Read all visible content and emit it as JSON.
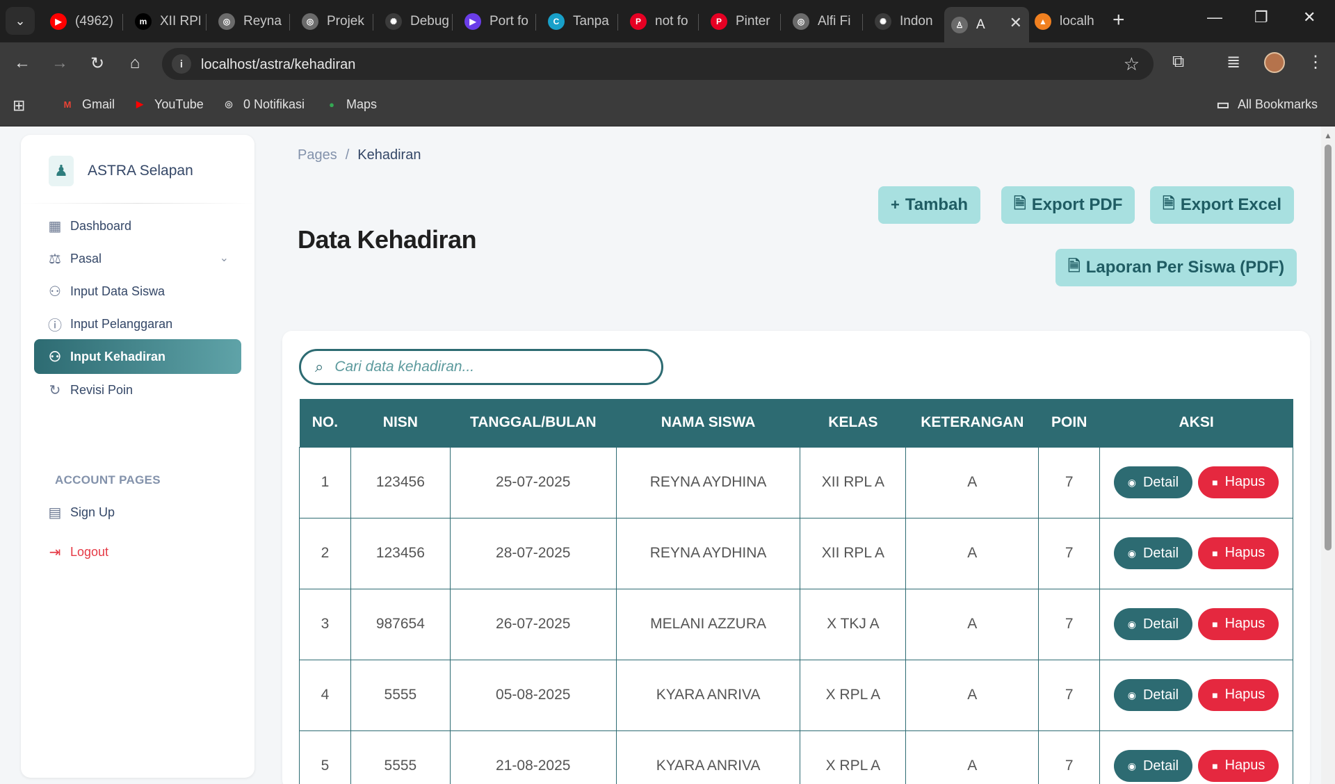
{
  "browser": {
    "tabs": [
      {
        "title": "(4962)",
        "fav_color": "#ff0000",
        "fav_glyph": "▶"
      },
      {
        "title": "XII RPL",
        "fav_color": "#000000",
        "fav_glyph": "m"
      },
      {
        "title": "Reyna",
        "fav_color": "#6b6b6b",
        "fav_glyph": "◎"
      },
      {
        "title": "Projek",
        "fav_color": "#6b6b6b",
        "fav_glyph": "◎"
      },
      {
        "title": "Debug",
        "fav_color": "#3b3b3b",
        "fav_glyph": "✺"
      },
      {
        "title": "Port fo",
        "fav_color": "#6a3de8",
        "fav_glyph": "▶"
      },
      {
        "title": "Tanpa",
        "fav_color": "#18a0c9",
        "fav_glyph": "C"
      },
      {
        "title": "not fo",
        "fav_color": "#e60023",
        "fav_glyph": "P"
      },
      {
        "title": "Pinter",
        "fav_color": "#e60023",
        "fav_glyph": "P"
      },
      {
        "title": "Alfi Fi",
        "fav_color": "#6b6b6b",
        "fav_glyph": "◎"
      },
      {
        "title": "Indon",
        "fav_color": "#3b3b3b",
        "fav_glyph": "✺"
      },
      {
        "title": "A",
        "fav_color": "#6b6b6b",
        "fav_glyph": "♙"
      },
      {
        "title": "localh",
        "fav_color": "#f08020",
        "fav_glyph": "▲"
      }
    ],
    "url": "localhost/astra/kehadiran",
    "bookmarks": [
      {
        "label": "Gmail",
        "color": "#ea4335",
        "glyph": "M"
      },
      {
        "label": "YouTube",
        "color": "#ff0000",
        "glyph": "▶"
      },
      {
        "label": "0 Notifikasi",
        "color": "#cfcfcf",
        "glyph": "◎"
      },
      {
        "label": "Maps",
        "color": "#34a853",
        "glyph": "●"
      }
    ],
    "all_bookmarks": "All Bookmarks"
  },
  "sidebar": {
    "brand": "ASTRA Selapan",
    "items": [
      {
        "label": "Dashboard",
        "icon": "dashboard-icon"
      },
      {
        "label": "Pasal",
        "icon": "gavel-icon"
      },
      {
        "label": "Input Data Siswa",
        "icon": "user-plus-icon"
      },
      {
        "label": "Input Pelanggaran",
        "icon": "alert-circle-icon"
      },
      {
        "label": "Input Kehadiran",
        "icon": "user-check-icon"
      },
      {
        "label": "Revisi Poin",
        "icon": "refresh-icon"
      }
    ],
    "section": "ACCOUNT PAGES",
    "account_items": [
      {
        "label": "Sign Up",
        "icon": "clipboard-icon"
      },
      {
        "label": "Logout",
        "icon": "logout-icon"
      }
    ]
  },
  "breadcrumb": {
    "root": "Pages",
    "separator": "/",
    "current": "Kehadiran"
  },
  "title": "Data Kehadiran",
  "actions": {
    "tambah": "Tambah",
    "export_pdf": "Export PDF",
    "export_excel": "Export Excel",
    "laporan": "Laporan Per Siswa (PDF)"
  },
  "search": {
    "placeholder": "Cari data kehadiran..."
  },
  "table": {
    "headers": [
      "NO.",
      "NISN",
      "TANGGAL/BULAN",
      "NAMA SISWA",
      "KELAS",
      "KETERANGAN",
      "POIN",
      "AKSI"
    ],
    "rows": [
      [
        "1",
        "123456",
        "25-07-2025",
        "REYNA AYDHINA",
        "XII RPL A",
        "A",
        "7"
      ],
      [
        "2",
        "123456",
        "28-07-2025",
        "REYNA AYDHINA",
        "XII RPL A",
        "A",
        "7"
      ],
      [
        "3",
        "987654",
        "26-07-2025",
        "MELANI AZZURA",
        "X TKJ A",
        "A",
        "7"
      ],
      [
        "4",
        "5555",
        "05-08-2025",
        "KYARA ANRIVA",
        "X RPL A",
        "A",
        "7"
      ],
      [
        "5",
        "5555",
        "21-08-2025",
        "KYARA ANRIVA",
        "X RPL A",
        "A",
        "7"
      ]
    ],
    "detail_label": "Detail",
    "hapus_label": "Hapus"
  },
  "colors": {
    "primary": "#2d6b72",
    "action_bg": "#a8e0e0",
    "danger": "#e5283f"
  }
}
